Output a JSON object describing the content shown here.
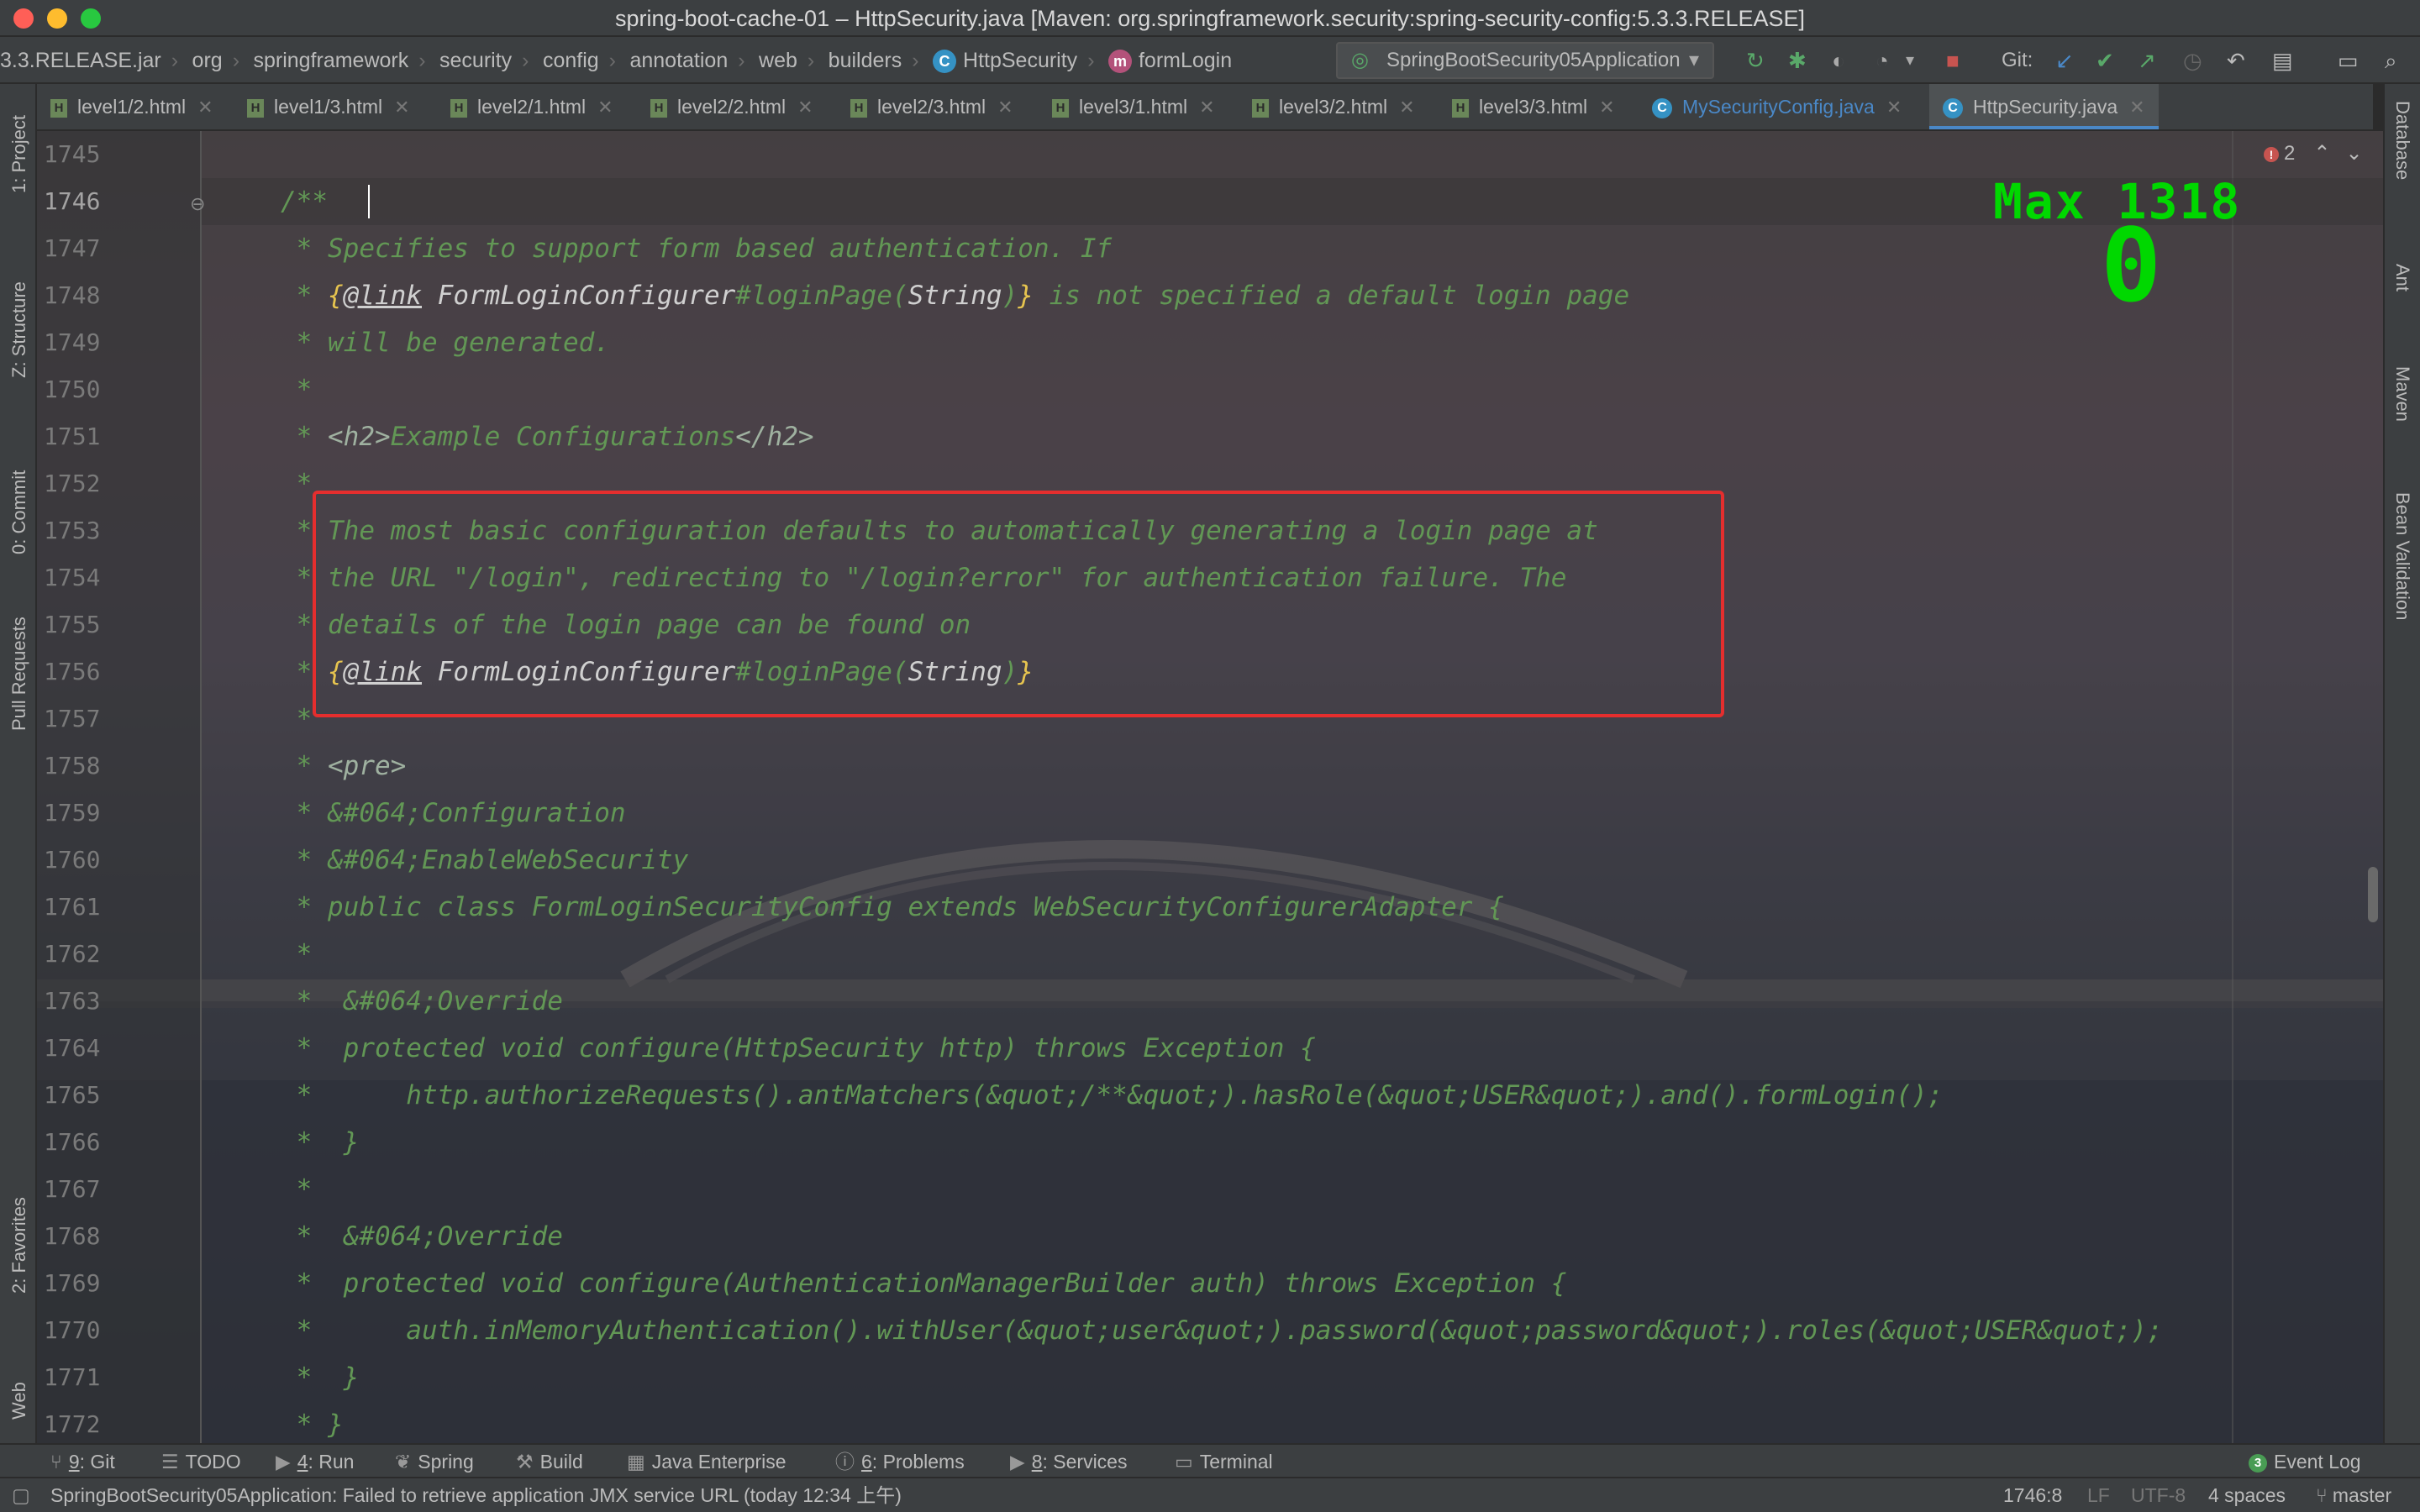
{
  "window": {
    "title": "spring-boot-cache-01 – HttpSecurity.java [Maven: org.springframework.security:spring-security-config:5.3.3.RELEASE]"
  },
  "breadcrumb": [
    "3.3.RELEASE.jar",
    "org",
    "springframework",
    "security",
    "config",
    "annotation",
    "web",
    "builders",
    "HttpSecurity",
    "formLogin"
  ],
  "toolbar": {
    "run_config": "SpringBootSecurity05Application",
    "git_label": "Git:"
  },
  "tabs": [
    {
      "label": "level1/2.html",
      "icon": "html-file-icon",
      "active": false
    },
    {
      "label": "level1/3.html",
      "icon": "html-file-icon",
      "active": false
    },
    {
      "label": "level2/1.html",
      "icon": "html-file-icon",
      "active": false
    },
    {
      "label": "level2/2.html",
      "icon": "html-file-icon",
      "active": false
    },
    {
      "label": "level2/3.html",
      "icon": "html-file-icon",
      "active": false
    },
    {
      "label": "level3/1.html",
      "icon": "html-file-icon",
      "active": false
    },
    {
      "label": "level3/2.html",
      "icon": "html-file-icon",
      "active": false
    },
    {
      "label": "level3/3.html",
      "icon": "html-file-icon",
      "active": false
    },
    {
      "label": "MySecurityConfig.java",
      "icon": "java-class-icon",
      "active": false
    },
    {
      "label": "HttpSecurity.java",
      "icon": "java-class-icon",
      "active": true
    }
  ],
  "left_tools": [
    "1: Project",
    "Z: Structure",
    "0: Commit",
    "Pull Requests",
    "2: Favorites",
    "Web"
  ],
  "right_tools": [
    "Database",
    "Ant",
    "Maven",
    "Bean Validation"
  ],
  "editor": {
    "line_numbers": [
      "1745",
      "1746",
      "1747",
      "1748",
      "1749",
      "1750",
      "1751",
      "1752",
      "1753",
      "1754",
      "1755",
      "1756",
      "1757",
      "1758",
      "1759",
      "1760",
      "1761",
      "1762",
      "1763",
      "1764",
      "1765",
      "1766",
      "1767",
      "1768",
      "1769",
      "1770",
      "1771",
      "1772"
    ],
    "current_line": "1746",
    "errors_count": "2",
    "lines": {
      "l1746": "/**",
      "l1747": " * Specifies to support form based authentication. If",
      "l1748_pre": " * ",
      "l1748_link": "@link",
      "l1748_ref": " FormLoginConfigurer",
      "l1748_mid": "#loginPage(",
      "l1748_cls": "String",
      "l1748_post": " is not specified a default login page",
      "l1749": " * will be generated.",
      "l1750": " *",
      "l1751_pre": " * ",
      "l1751_tag1": "<h2>",
      "l1751_txt": "Example Configurations",
      "l1751_tag2": "</h2>",
      "l1752": " *",
      "l1753": " * The most basic configuration defaults to automatically generating a login page at",
      "l1754": " * the URL \"/login\", redirecting to \"/login?error\" for authentication failure. The",
      "l1755": " * details of the login page can be found on",
      "l1756_pre": " * ",
      "l1756_link": "@link",
      "l1756_ref": " FormLoginConfigurer",
      "l1756_mid": "#loginPage(",
      "l1756_cls": "String",
      "l1757": " *",
      "l1758_pre": " * ",
      "l1758_tag": "<pre>",
      "l1759": " * &#064;Configuration",
      "l1760": " * &#064;EnableWebSecurity",
      "l1761": " * public class FormLoginSecurityConfig extends WebSecurityConfigurerAdapter {",
      "l1762": " *",
      "l1763": " *  &#064;Override",
      "l1764": " *  protected void configure(HttpSecurity http) throws Exception {",
      "l1765": " *      http.authorizeRequests().antMatchers(&quot;/**&quot;).hasRole(&quot;USER&quot;).and().formLogin();",
      "l1766": " *  }",
      "l1767": " *",
      "l1768": " *  &#064;Override",
      "l1769": " *  protected void configure(AuthenticationManagerBuilder auth) throws Exception {",
      "l1770": " *      auth.inMemoryAuthentication().withUser(&quot;user&quot;).password(&quot;password&quot;).roles(&quot;USER&quot;);",
      "l1771": " *  }",
      "l1772": " * }"
    }
  },
  "overlay": {
    "max_label": "Max 1318",
    "counter": "0"
  },
  "bottom_tools": [
    {
      "num": "9",
      "label": ": Git"
    },
    {
      "num": "",
      "label": "TODO"
    },
    {
      "num": "4",
      "label": ": Run"
    },
    {
      "num": "",
      "label": "Spring"
    },
    {
      "num": "",
      "label": "Build"
    },
    {
      "num": "",
      "label": "Java Enterprise"
    },
    {
      "num": "6",
      "label": ": Problems"
    },
    {
      "num": "8",
      "label": ": Services"
    },
    {
      "num": "",
      "label": "Terminal"
    },
    {
      "num": "3",
      "label": "Event Log"
    }
  ],
  "status": {
    "message": "SpringBootSecurity05Application: Failed to retrieve application JMX service URL (today 12:34 上午)",
    "position": "1746:8",
    "line_sep": "LF",
    "encoding": "UTF-8",
    "indent": "4 spaces",
    "branch": "master"
  },
  "colors": {
    "accent": "#4a88c7",
    "comment": "#629755",
    "highlight_box": "#e52e2e",
    "overlay_text": "#00d800"
  }
}
